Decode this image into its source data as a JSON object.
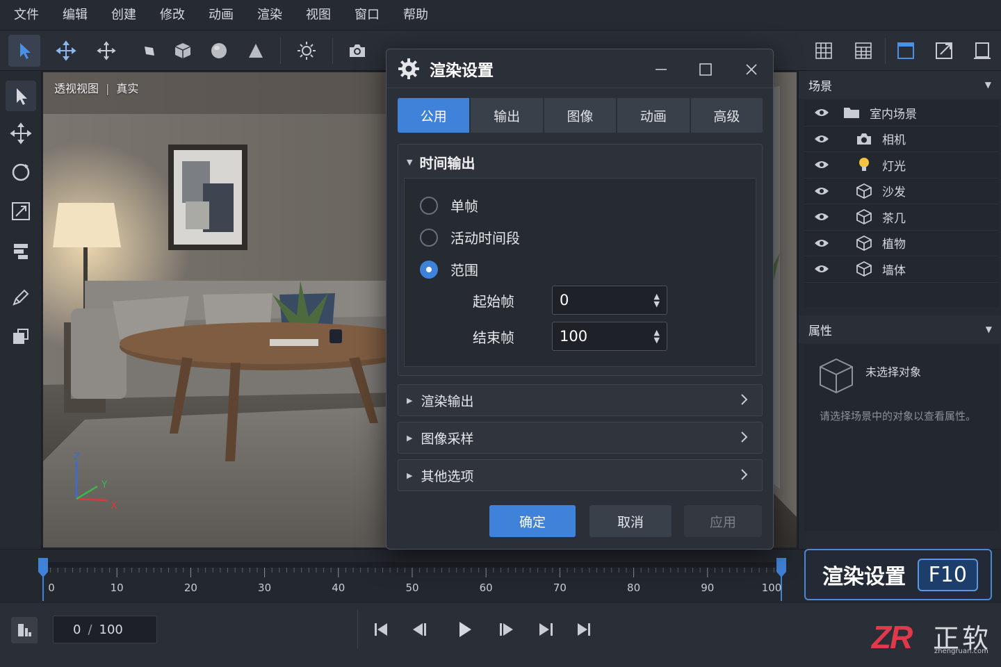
{
  "menubar": {
    "items": [
      "文件",
      "编辑",
      "创建",
      "修改",
      "动画",
      "渲染",
      "视图",
      "窗口",
      "帮助"
    ]
  },
  "viewport": {
    "view_name": "透视视图",
    "separator": "|",
    "shading_mode": "真实",
    "axis_labels": {
      "x": "X",
      "y": "Y",
      "z": "Z"
    }
  },
  "dialog": {
    "title": "渲染设置",
    "tabs": [
      "公用",
      "输出",
      "图像",
      "动画",
      "高级"
    ],
    "active_tab": 0,
    "time_output": {
      "header": "时间输出",
      "options": [
        "单帧",
        "活动时间段",
        "范围"
      ],
      "selected": 2,
      "start_label": "起始帧",
      "start_value": "0",
      "end_label": "结束帧",
      "end_value": "100"
    },
    "collapsed_sections": [
      "渲染输出",
      "图像采样",
      "其他选项"
    ],
    "buttons": {
      "ok": "确定",
      "cancel": "取消",
      "apply": "应用"
    }
  },
  "scene_panel": {
    "title": "场景",
    "root": "室内场景",
    "items": [
      {
        "label": "相机",
        "icon": "camera-icon"
      },
      {
        "label": "灯光",
        "icon": "light-bulb-icon"
      },
      {
        "label": "沙发",
        "icon": "cube-icon"
      },
      {
        "label": "茶几",
        "icon": "cube-icon"
      },
      {
        "label": "植物",
        "icon": "cube-icon"
      },
      {
        "label": "墙体",
        "icon": "cube-icon"
      }
    ]
  },
  "properties_panel": {
    "title": "属性",
    "no_selection": "未选择对象",
    "hint": "请选择场景中的对象以查看属性。"
  },
  "timeline": {
    "min": 0,
    "max": 100,
    "labels": [
      "0",
      "10",
      "20",
      "30",
      "40",
      "50",
      "60",
      "70",
      "80",
      "90",
      "100"
    ],
    "range_start": 0,
    "range_end": 100
  },
  "shortcut": {
    "label": "渲染设置",
    "key": "F10"
  },
  "playback": {
    "current_frame": "0",
    "separator": "/",
    "total_frames": "100"
  },
  "logo": {
    "mark": "ZR",
    "name": "正软",
    "url_text": "zhengruan.com"
  },
  "colors": {
    "accent": "#3f82d9",
    "background": "#1f232a",
    "panel": "#262a31",
    "dialog": "#2b3038",
    "logo_red": "#e0394b"
  }
}
